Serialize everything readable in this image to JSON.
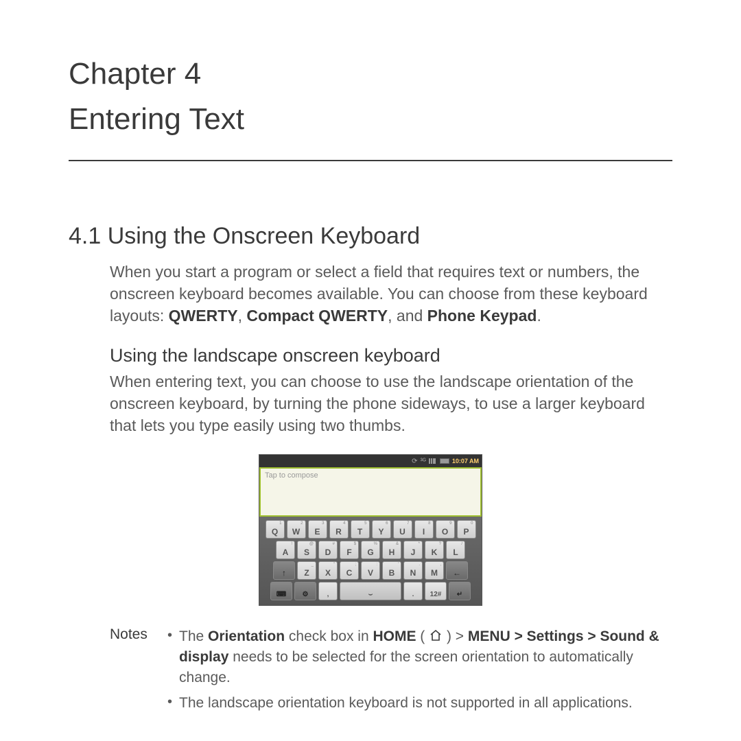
{
  "chapter": {
    "number": "Chapter 4",
    "title": "Entering Text"
  },
  "section": {
    "number_title": "4.1  Using the Onscreen Keyboard",
    "intro_pre": "When you start a program or select a field that requires text or numbers, the onscreen keyboard becomes available. You can choose from these keyboard layouts: ",
    "layouts_bold1": "QWERTY",
    "layouts_sep1": ", ",
    "layouts_bold2": "Compact QWERTY",
    "layouts_sep2": ", and ",
    "layouts_bold3": "Phone Keypad",
    "intro_end": "."
  },
  "subsection": {
    "title": "Using the landscape onscreen keyboard",
    "body": "When entering text, you can choose to use the landscape orientation of the onscreen keyboard, by turning the phone sideways, to use a larger keyboard that lets you type easily using two thumbs."
  },
  "keyboard": {
    "status_time": "10:07 AM",
    "placeholder": "Tap to compose",
    "row1": [
      "Q",
      "W",
      "E",
      "R",
      "T",
      "Y",
      "U",
      "I",
      "O",
      "P"
    ],
    "row1_sup": [
      "1",
      "2",
      "3",
      "4",
      "5",
      "6",
      "7",
      "8",
      "9",
      "0"
    ],
    "row2": [
      "A",
      "S",
      "D",
      "F",
      "G",
      "H",
      "J",
      "K",
      "L"
    ],
    "row2_sup": [
      "!",
      "@",
      "#",
      "$",
      "%",
      "&",
      "*",
      "?",
      "/"
    ],
    "row3": [
      "Z",
      "X",
      "C",
      "V",
      "B",
      "N",
      "M"
    ],
    "row3_sup": [
      "_",
      "\"",
      ";",
      ":",
      "'",
      ".",
      ","
    ],
    "shift": "↑",
    "backspace": "←",
    "sym1_icon": "⌨",
    "sym2_icon": "⚙",
    "numkey": "12#",
    "enter": "↵",
    "space": "⌣",
    "comma": ",",
    "period": "."
  },
  "notes": {
    "label": "Notes",
    "item1_pre": "The ",
    "item1_bold1": "Orientation",
    "item1_mid1": " check box in ",
    "item1_bold2": "HOME",
    "item1_mid2": " ( ",
    "item1_mid3": " ) > ",
    "item1_bold3": "MENU > Settings > Sound & display",
    "item1_end": " needs to be selected for the screen orientation to automatically change.",
    "item2": "The landscape orientation keyboard is not supported in all applications."
  }
}
